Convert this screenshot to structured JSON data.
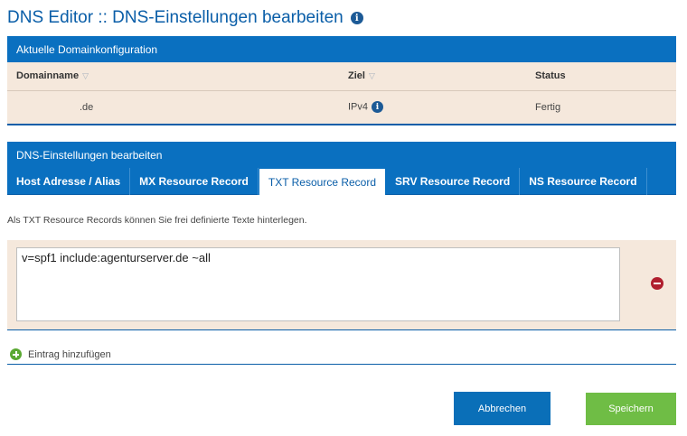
{
  "page": {
    "title": "DNS Editor :: DNS-Einstellungen bearbeiten",
    "title_icon": "info-icon"
  },
  "domain_config": {
    "header": "Aktuelle Domainkonfiguration",
    "columns": [
      "Domainname",
      "Ziel",
      "Status"
    ],
    "row": {
      "domain": ".de",
      "target": "IPv4",
      "status": "Fertig"
    }
  },
  "dns_settings": {
    "header": "DNS-Einstellungen bearbeiten",
    "tabs": [
      {
        "label": "Host Adresse / Alias",
        "active": false
      },
      {
        "label": "MX Resource Record",
        "active": false
      },
      {
        "label": "TXT Resource Record",
        "active": true
      },
      {
        "label": "SRV Resource Record",
        "active": false
      },
      {
        "label": "NS Resource Record",
        "active": false
      }
    ],
    "hint": "Als TXT Resource Records können Sie frei definierte Texte hinterlegen.",
    "txt_value": "v=spf1 include:agenturserver.de ~all",
    "add_entry_label": "Eintrag hinzufügen"
  },
  "buttons": {
    "cancel": "Abbrechen",
    "save": "Speichern"
  },
  "colors": {
    "primary_blue": "#0a70c0",
    "row_bg": "#f5e8dc",
    "save_green": "#6fbd45",
    "remove_red": "#b01e2e"
  }
}
